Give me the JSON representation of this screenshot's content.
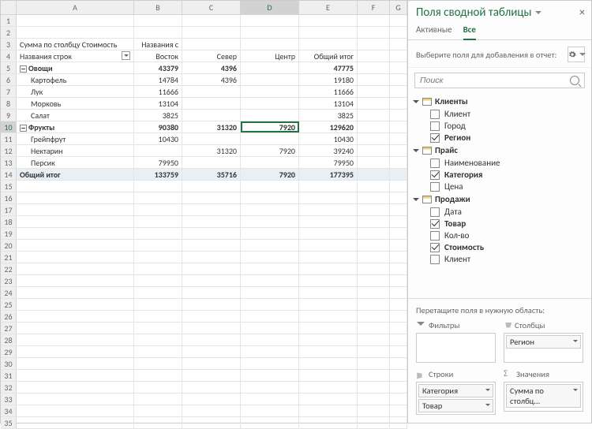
{
  "columns": [
    "A",
    "B",
    "C",
    "D",
    "E",
    "F",
    "G"
  ],
  "grid": {
    "r3": {
      "A": "Сумма по столбцу Стоимость",
      "B": "Названия с"
    },
    "r4": {
      "A": "Названия строк",
      "B": "Восток",
      "C": "Север",
      "D": "Центр",
      "E": "Общий итог"
    },
    "r5": {
      "A": "Овощи",
      "B": "43379",
      "C": "4396",
      "D": "",
      "E": "47775"
    },
    "r6": {
      "A": "Картофель",
      "B": "14784",
      "C": "4396",
      "D": "",
      "E": "19180"
    },
    "r7": {
      "A": "Лук",
      "B": "11666",
      "C": "",
      "D": "",
      "E": "11666"
    },
    "r8": {
      "A": "Морковь",
      "B": "13104",
      "C": "",
      "D": "",
      "E": "13104"
    },
    "r9": {
      "A": "Салат",
      "B": "3825",
      "C": "",
      "D": "",
      "E": "3825"
    },
    "r10": {
      "A": "Фрукты",
      "B": "90380",
      "C": "31320",
      "D": "7920",
      "E": "129620"
    },
    "r11": {
      "A": "Грейпфрут",
      "B": "10430",
      "C": "",
      "D": "",
      "E": "10430"
    },
    "r12": {
      "A": "Нектарин",
      "B": "",
      "C": "31320",
      "D": "7920",
      "E": "39240"
    },
    "r13": {
      "A": "Персик",
      "B": "79950",
      "C": "",
      "D": "",
      "E": "79950"
    },
    "r14": {
      "A": "Общий итог",
      "B": "133759",
      "C": "35716",
      "D": "7920",
      "E": "177395"
    }
  },
  "selected_cell": "D10",
  "selected_value": "7920",
  "pane": {
    "title": "Поля сводной таблицы",
    "tabs": {
      "active": "Активные",
      "all": "Все"
    },
    "choose_label": "Выберите поля для добавления в отчет:",
    "search_placeholder": "Поиск",
    "groups": [
      {
        "name": "Клиенты",
        "fields": [
          {
            "label": "Клиент",
            "checked": false
          },
          {
            "label": "Город",
            "checked": false
          },
          {
            "label": "Регион",
            "checked": true
          }
        ]
      },
      {
        "name": "Прайс",
        "fields": [
          {
            "label": "Наименование",
            "checked": false
          },
          {
            "label": "Категория",
            "checked": true
          },
          {
            "label": "Цена",
            "checked": false
          }
        ]
      },
      {
        "name": "Продажи",
        "fields": [
          {
            "label": "Дата",
            "checked": false
          },
          {
            "label": "Товар",
            "checked": true
          },
          {
            "label": "Кол-во",
            "checked": false
          },
          {
            "label": "Стоимость",
            "checked": true
          },
          {
            "label": "Клиент",
            "checked": false
          }
        ]
      }
    ],
    "drag_label": "Перетащите поля в нужную область:",
    "zones": {
      "filters": {
        "label": "Фильтры",
        "items": []
      },
      "columns": {
        "label": "Столбцы",
        "items": [
          "Регион"
        ]
      },
      "rows": {
        "label": "Строки",
        "items": [
          "Категория",
          "Товар"
        ]
      },
      "values": {
        "label": "Значения",
        "items": [
          "Сумма по столбц..."
        ]
      }
    }
  }
}
